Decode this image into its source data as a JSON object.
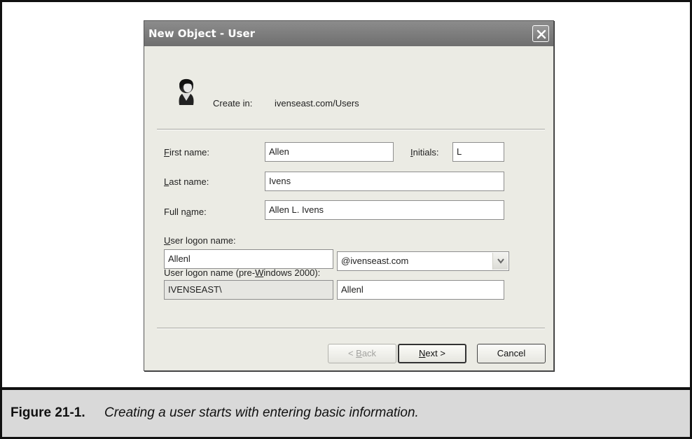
{
  "caption": {
    "label": "Figure 21-1.",
    "text": "Creating a user starts with entering basic information."
  },
  "dialog": {
    "title": "New Object - User",
    "create_in_label": "Create in:",
    "create_in_value": "ivenseast.com/Users",
    "fields": {
      "first_name": {
        "label": "First name:",
        "mnemonic": "F",
        "value": "Allen"
      },
      "initials": {
        "label": "Initials:",
        "mnemonic": "I",
        "value": "L"
      },
      "last_name": {
        "label": "Last name:",
        "mnemonic": "L",
        "value": "Ivens"
      },
      "full_name": {
        "label": "Full name:",
        "mnemonic": "a",
        "value": "Allen L. Ivens"
      },
      "logon_name": {
        "label": "User logon name:",
        "mnemonic": "U",
        "value": "Allenl",
        "domain": "@ivenseast.com"
      },
      "pre2000": {
        "label": "User logon name (pre-Windows 2000):",
        "mnemonic": "W",
        "domain_prefix": "IVENSEAST\\",
        "value": "Allenl"
      }
    },
    "buttons": {
      "back": "< Back",
      "next": "Next >",
      "cancel": "Cancel"
    },
    "icons": {
      "user": "user-icon",
      "close": "close-icon",
      "dropdown": "chevron-down-icon"
    }
  }
}
